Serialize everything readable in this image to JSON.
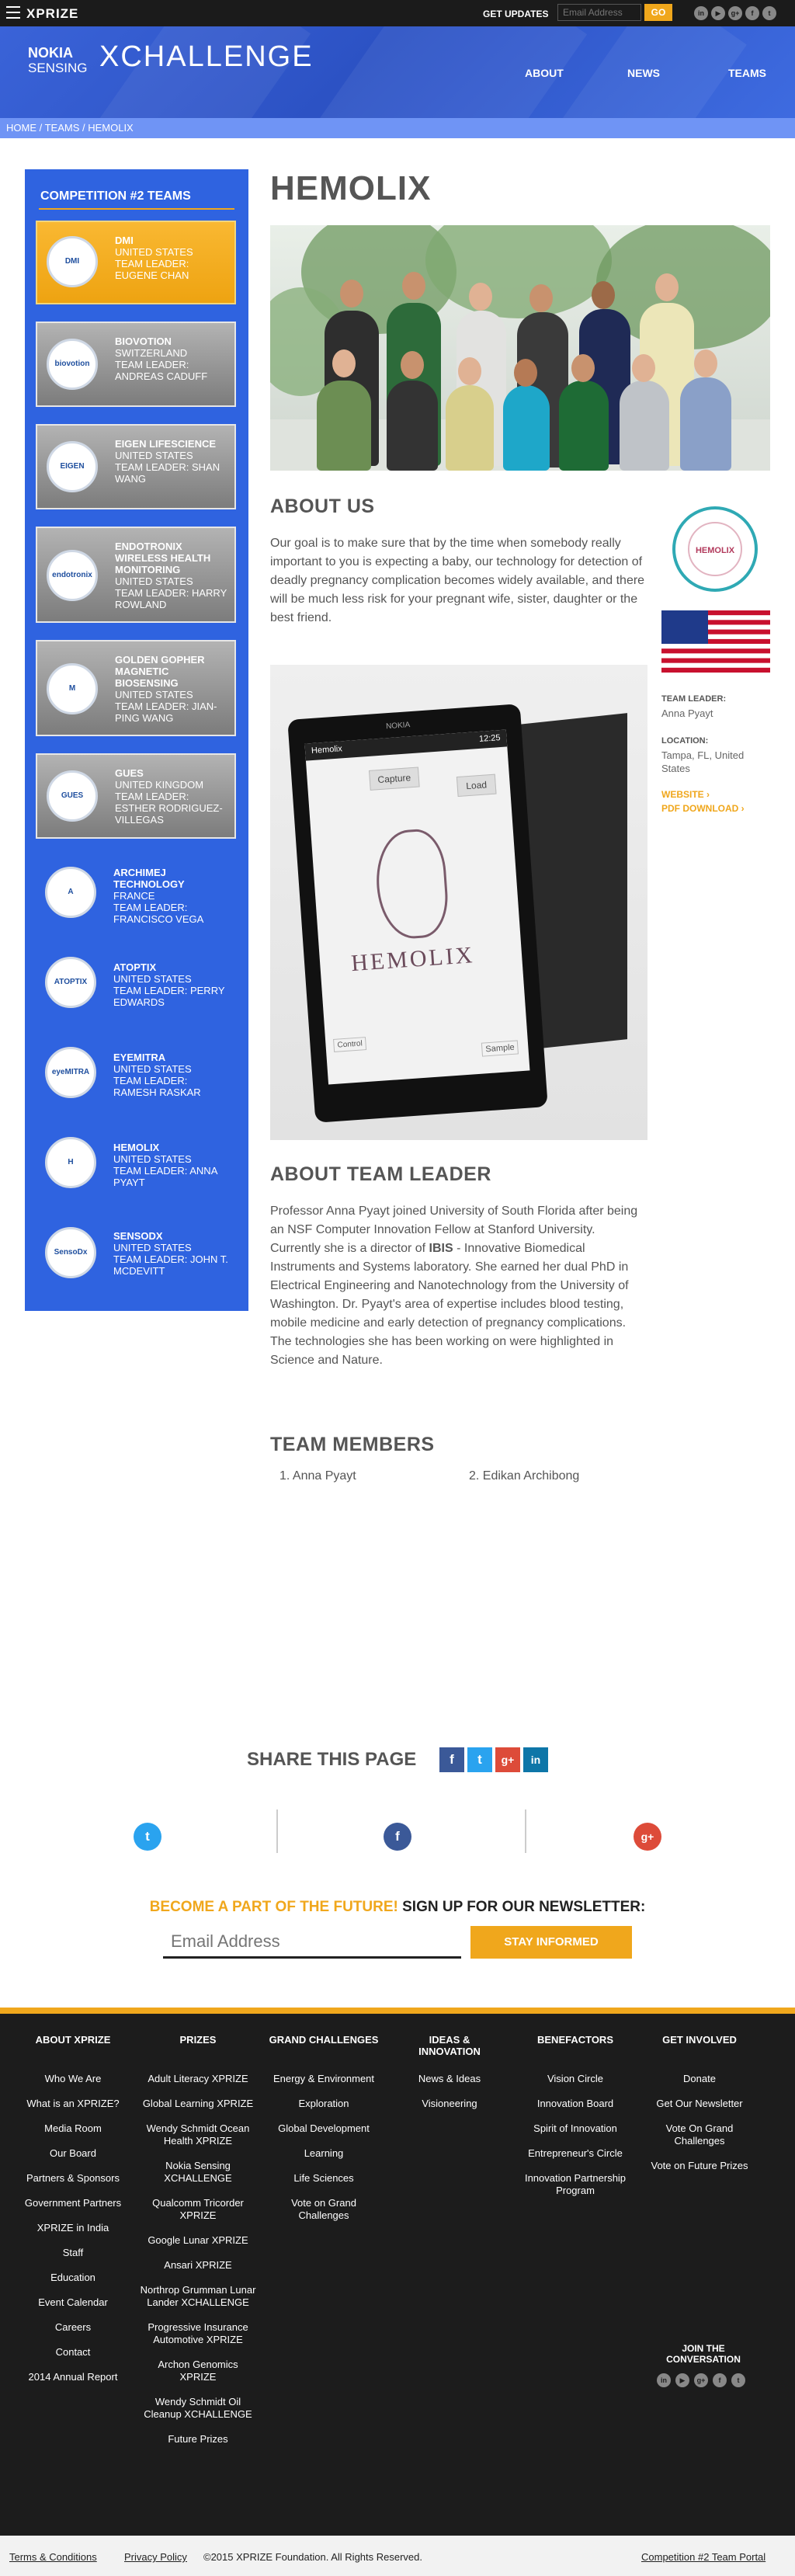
{
  "topbar": {
    "logo": "XPRIZE",
    "get_updates": "GET UPDATES",
    "email_placeholder": "Email Address",
    "go": "GO",
    "social": [
      "in",
      "▶",
      "g+",
      "f",
      "t"
    ]
  },
  "header": {
    "logo_line1": "NOKIA",
    "logo_line2": "SENSING",
    "logo_main": "XCHALLENGE",
    "nav": [
      "ABOUT",
      "NEWS",
      "TEAMS"
    ]
  },
  "breadcrumb": "HOME / TEAMS / HEMOLIX",
  "sidebar": {
    "title": "COMPETITION #2 TEAMS",
    "teams": [
      {
        "name": "DMI",
        "country": "UNITED STATES",
        "leader": "TEAM LEADER: EUGENE CHAN",
        "logo": "DMI"
      },
      {
        "name": "BIOVOTION",
        "country": "SWITZERLAND",
        "leader": "TEAM LEADER: ANDREAS CADUFF",
        "logo": "biovotion"
      },
      {
        "name": "EIGEN LIFESCIENCE",
        "country": "UNITED STATES",
        "leader": "TEAM LEADER: SHAN WANG",
        "logo": "EIGEN"
      },
      {
        "name": "ENDOTRONIX WIRELESS HEALTH MONITORING",
        "country": "UNITED STATES",
        "leader": "TEAM LEADER: HARRY ROWLAND",
        "logo": "endotronix"
      },
      {
        "name": "GOLDEN GOPHER MAGNETIC BIOSENSING",
        "country": "UNITED STATES",
        "leader": "TEAM LEADER: JIAN-PING WANG",
        "logo": "M"
      },
      {
        "name": "GUES",
        "country": "UNITED KINGDOM",
        "leader": "TEAM LEADER: ESTHER RODRIGUEZ-VILLEGAS",
        "logo": "GUES"
      },
      {
        "name": "ARCHIMEJ TECHNOLOGY",
        "country": "FRANCE",
        "leader": "TEAM LEADER: FRANCISCO VEGA",
        "logo": "A"
      },
      {
        "name": "ATOPTIX",
        "country": "UNITED STATES",
        "leader": "TEAM LEADER: PERRY EDWARDS",
        "logo": "ATOPTIX"
      },
      {
        "name": "EYEMITRA",
        "country": "UNITED STATES",
        "leader": "TEAM LEADER: RAMESH RASKAR",
        "logo": "eyeMITRA"
      },
      {
        "name": "HEMOLIX",
        "country": "UNITED STATES",
        "leader": "TEAM LEADER: ANNA PYAYT",
        "logo": "H"
      },
      {
        "name": "SENSODX",
        "country": "UNITED STATES",
        "leader": "TEAM LEADER: JOHN T. MCDEVITT",
        "logo": "SensoDx"
      }
    ]
  },
  "main": {
    "title": "HEMOLIX",
    "about_us_heading": "ABOUT US",
    "about_us_text": "Our goal is to make sure that by the time when somebody really important to you is expecting a baby, our technology for detection of deadly pregnancy complication becomes widely available, and there will be much less risk for your pregnant wife, sister, daughter or the best friend.",
    "device_screen": {
      "brand": "NOKIA",
      "app_title": "Hemolix",
      "time": "12:25",
      "capture": "Capture",
      "load": "Load",
      "logo_text": "HEMOLIX",
      "control": "Control",
      "sample": "Sample"
    },
    "team_leader_heading": "ABOUT TEAM LEADER",
    "team_leader_text_1": "Professor Anna Pyayt joined University of South Florida after being an NSF Computer Innovation Fellow at Stanford University.  Currently she is a director of ",
    "team_leader_bold": "IBIS",
    "team_leader_text_2": " - Innovative Biomedical Instruments and Systems laboratory.  She earned her dual PhD in Electrical Engineering and Nanotechnology from the University of Washington.  Dr. Pyayt's area of expertise includes blood testing, mobile medicine and early detection of pregnancy complications. The technologies she has been working on were highlighted in Science and Nature.",
    "members_heading": "TEAM MEMBERS",
    "members": [
      "1.  Anna Pyayt",
      "2.  Edikan Archibong"
    ]
  },
  "side_info": {
    "badge_text": "HEMOLIX",
    "team_leader_label": "TEAM LEADER:",
    "team_leader_value": "Anna Pyayt",
    "location_label": "LOCATION:",
    "location_value": "Tampa, FL, United States",
    "website": "WEBSITE ›",
    "pdf": "PDF DOWNLOAD ›"
  },
  "share": {
    "title": "SHARE THIS PAGE",
    "buttons": [
      "f",
      "t",
      "g+",
      "in"
    ]
  },
  "newsletter": {
    "orange": "BECOME A PART OF THE FUTURE!",
    "dark": " SIGN UP FOR OUR NEWSLETTER:",
    "placeholder": "Email Address",
    "button": "STAY INFORMED"
  },
  "footer": {
    "columns": [
      {
        "title": "ABOUT XPRIZE",
        "items": [
          "Who We Are",
          "What is an XPRIZE?",
          "Media Room",
          "Our Board",
          "Partners & Sponsors",
          "Government Partners",
          "XPRIZE in India",
          "Staff",
          "Education",
          "Event Calendar",
          "Careers",
          "Contact",
          "2014 Annual Report"
        ]
      },
      {
        "title": "PRIZES",
        "items": [
          "Adult Literacy XPRIZE",
          "Global Learning XPRIZE",
          "Wendy Schmidt Ocean Health XPRIZE",
          "Nokia Sensing XCHALLENGE",
          "Qualcomm Tricorder XPRIZE",
          "Google Lunar XPRIZE",
          "Ansari XPRIZE",
          "Northrop Grumman Lunar Lander XCHALLENGE",
          "Progressive Insurance Automotive XPRIZE",
          "Archon Genomics XPRIZE",
          "Wendy Schmidt Oil Cleanup XCHALLENGE",
          "Future Prizes"
        ]
      },
      {
        "title": "GRAND CHALLENGES",
        "items": [
          "Energy & Environment",
          "Exploration",
          "Global Development",
          "Learning",
          "Life Sciences",
          "Vote on Grand Challenges"
        ]
      },
      {
        "title": "IDEAS & INNOVATION",
        "items": [
          "News & Ideas",
          "Visioneering"
        ]
      },
      {
        "title": "BENEFACTORS",
        "items": [
          "Vision Circle",
          "Innovation Board",
          "Spirit of Innovation",
          "Entrepreneur's Circle",
          "Innovation Partnership Program"
        ]
      },
      {
        "title": "GET INVOLVED",
        "items": [
          "Donate",
          "Get Our Newsletter",
          "Vote On Grand Challenges",
          "Vote on Future Prizes"
        ]
      }
    ],
    "join": "JOIN THE CONVERSATION",
    "social": [
      "in",
      "▶",
      "g+",
      "f",
      "t"
    ]
  },
  "bottom": {
    "terms": "Terms & Conditions",
    "privacy": "Privacy Policy",
    "copyright": "©2015 XPRIZE Foundation. All Rights Reserved.",
    "portal": "Competition #2 Team Portal"
  },
  "colors": {
    "accent": "#f0a71c",
    "header_blue": "#2f5bd6",
    "sidebar_blue": "#2f63e0",
    "footer": "#1c1c1c"
  }
}
